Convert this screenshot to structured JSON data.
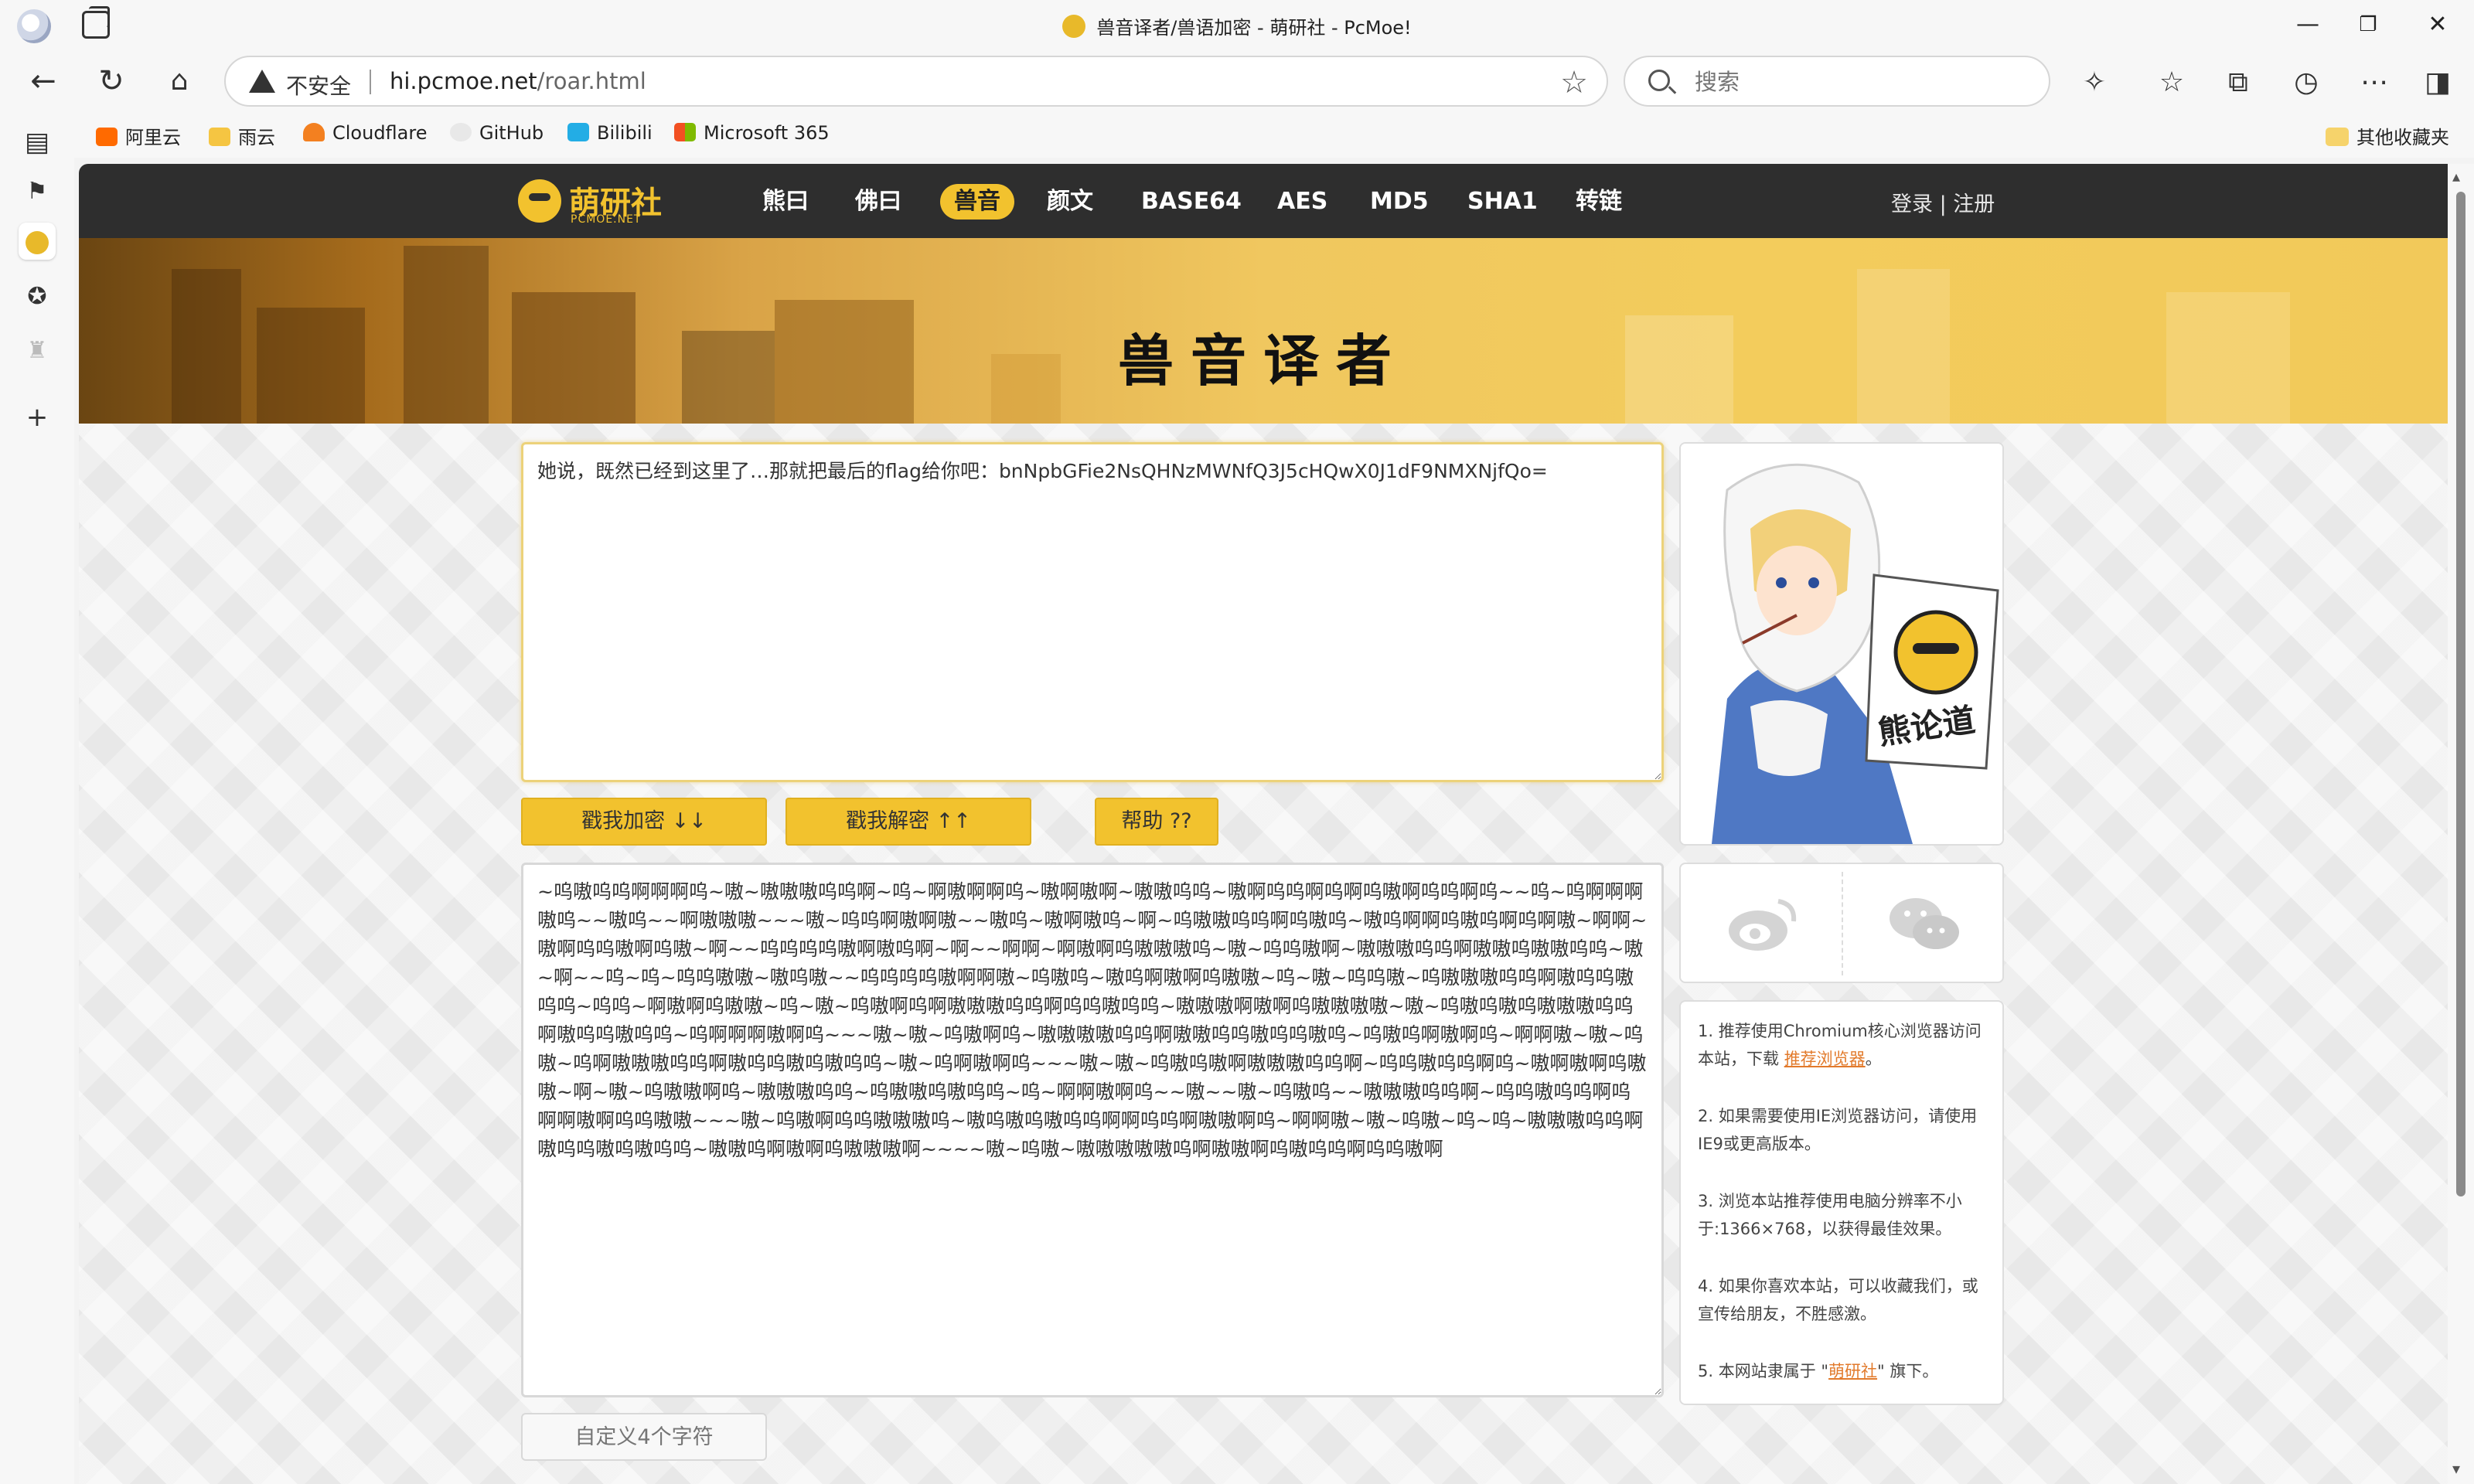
{
  "browser": {
    "window_title": "兽音译者/兽语加密 - 萌研社 - PcMoe!",
    "address": {
      "security_label": "不安全",
      "host": "hi.pcmoe.net",
      "path": "/roar.html"
    },
    "search_placeholder": "搜索",
    "bookmarks": [
      {
        "label": "阿里云",
        "icon": "aliyun-icon",
        "color": "#ff6a00"
      },
      {
        "label": "雨云",
        "icon": "rainyun-icon",
        "color": "#f5c542"
      },
      {
        "label": "Cloudflare",
        "icon": "cloudflare-icon",
        "color": "#f38020"
      },
      {
        "label": "GitHub",
        "icon": "github-icon",
        "color": "#e8e8e8"
      },
      {
        "label": "Bilibili",
        "icon": "bilibili-icon",
        "color": "#23ade5"
      },
      {
        "label": "Microsoft 365",
        "icon": "microsoft-icon",
        "color": "#f25022"
      }
    ],
    "other_bookmarks": "其他收藏夹"
  },
  "site": {
    "logo": {
      "name": "萌研社",
      "sub": "PCMOE.NET"
    },
    "menu": [
      "熊曰",
      "佛曰",
      "兽音",
      "颜文",
      "BASE64",
      "AES",
      "MD5",
      "SHA1",
      "转链"
    ],
    "active_menu": "兽音",
    "auth": "登录 | 注册",
    "banner_title": "兽音译者",
    "input_text": "她说，既然已经到这里了…那就把最后的flag给你吧：bnNpbGFie2NsQHNzMWNfQ3J5cHQwX0J1dF9NMXNjfQo=",
    "buttons": {
      "encrypt": "戳我加密 ↓↓",
      "decrypt": "戳我解密 ↑↑",
      "help": "帮助 ??"
    },
    "output_text": "~呜嗷呜呜啊啊啊呜~嗷~嗷嗷嗷呜呜啊~呜~啊嗷啊啊呜~嗷啊嗷啊~嗷嗷呜呜~嗷啊呜呜啊呜啊呜嗷啊呜呜啊呜~~呜~呜啊啊啊嗷呜~~嗷呜~~啊嗷嗷嗷~~~嗷~呜呜啊嗷啊嗷~~嗷呜~嗷啊嗷呜~啊~呜嗷嗷呜呜啊呜嗷呜~嗷呜啊啊呜嗷呜啊呜啊嗷~啊啊~嗷啊呜呜嗷啊呜嗷~啊~~呜呜呜呜嗷啊嗷呜啊~啊~~啊啊~啊嗷啊呜嗷嗷嗷呜~嗷~呜呜嗷啊~嗷嗷嗷呜呜啊嗷嗷呜嗷嗷呜呜~嗷~啊~~呜~呜~呜呜嗷嗷~嗷呜嗷~~呜呜呜呜嗷啊啊嗷~呜嗷呜~嗷呜啊嗷啊呜嗷嗷~呜~嗷~呜呜嗷~呜嗷嗷嗷呜呜啊嗷呜呜嗷呜呜~呜呜~啊嗷啊呜嗷嗷~呜~嗷~呜嗷啊呜啊嗷嗷嗷呜呜啊呜呜嗷呜呜~嗷嗷嗷啊嗷啊呜嗷嗷嗷嗷~嗷~呜嗷呜嗷呜嗷嗷嗷呜呜啊嗷呜呜嗷呜呜~呜啊啊啊嗷啊呜~~~嗷~嗷~呜嗷啊呜~嗷嗷嗷嗷呜呜啊嗷嗷呜呜嗷呜呜嗷呜~呜嗷呜啊嗷啊呜~啊啊嗷~嗷~呜嗷~呜啊嗷嗷嗷呜呜啊嗷呜呜嗷呜嗷呜呜~嗷~呜啊嗷啊呜~~~嗷~嗷~呜嗷呜嗷啊嗷嗷嗷呜呜啊~呜呜嗷呜呜啊呜~嗷啊嗷啊呜嗷嗷~啊~嗷~呜嗷嗷啊呜~嗷嗷嗷呜呜~呜嗷嗷呜嗷呜呜~呜~啊啊嗷啊呜~~嗷~~嗷~呜嗷呜~~嗷嗷嗷呜呜啊~呜呜嗷呜呜啊呜啊啊嗷啊呜呜嗷嗷~~~嗷~呜嗷啊呜呜嗷嗷嗷呜~嗷呜嗷呜嗷呜呜啊啊呜呜啊嗷嗷啊呜~啊啊嗷~嗷~呜嗷~呜~呜~嗷嗷嗷呜呜啊嗷呜呜嗷呜嗷呜呜~嗷嗷呜啊嗷啊呜嗷嗷嗷啊~~~~嗷~呜嗷~嗷嗷嗷嗷嗷呜啊嗷嗷啊呜嗷呜呜啊呜呜嗷啊",
    "custom_placeholder": "自定义4个字符",
    "illustration_caption": "熊论道",
    "notes": [
      {
        "text": "1. 推荐使用Chromium核心浏览器访问本站，下载 ",
        "link": "推荐浏览器",
        "after": "。"
      },
      {
        "text": "2. 如果需要使用IE浏览器访问，请使用IE9或更高版本。",
        "link": "",
        "after": ""
      },
      {
        "text": "3. 浏览本站推荐使用电脑分辨率不小于:1366×768，以获得最佳效果。",
        "link": "",
        "after": ""
      },
      {
        "text": "4. 如果你喜欢本站，可以收藏我们，或宣传给朋友，不胜感激。",
        "link": "",
        "after": ""
      },
      {
        "text": "5. 本网站隶属于 \"",
        "link": "萌研社",
        "after": "\" 旗下。"
      }
    ],
    "colors": {
      "accent": "#f2c22e",
      "nav_bg": "#2e2e2e",
      "link": "#e27a2b"
    }
  }
}
